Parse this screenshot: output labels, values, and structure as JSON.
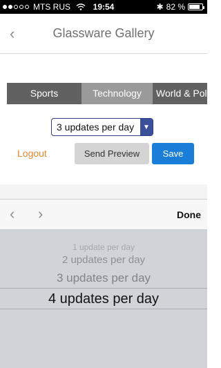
{
  "status_bar": {
    "carrier": "MTS RUS",
    "time": "19:54",
    "battery": "82 %",
    "battery_level": 0.82,
    "signal_bars_filled": 2,
    "signal_bars_total": 5
  },
  "nav": {
    "back_icon": "‹",
    "title": "Glassware Gallery"
  },
  "tabs": [
    {
      "label": "Sports"
    },
    {
      "label": "Technology"
    },
    {
      "label": "World & Pol"
    }
  ],
  "select": {
    "value": "3 updates per day",
    "arrow": "▼"
  },
  "actions": {
    "logout": "Logout",
    "send_preview": "Send Preview",
    "save": "Save"
  },
  "picker": {
    "prev_icon": "‹",
    "next_icon": "›",
    "done": "Done",
    "options": [
      "1 update per day",
      "2 updates per day",
      "3 updates per day",
      "4 updates per day"
    ]
  },
  "colors": {
    "accent_blue": "#1a7ed8",
    "logout_orange": "#e2892f",
    "tab_dark": "#616161",
    "tab_selected": "#9a9a9a",
    "picker_bg": "#d0d4d9"
  }
}
